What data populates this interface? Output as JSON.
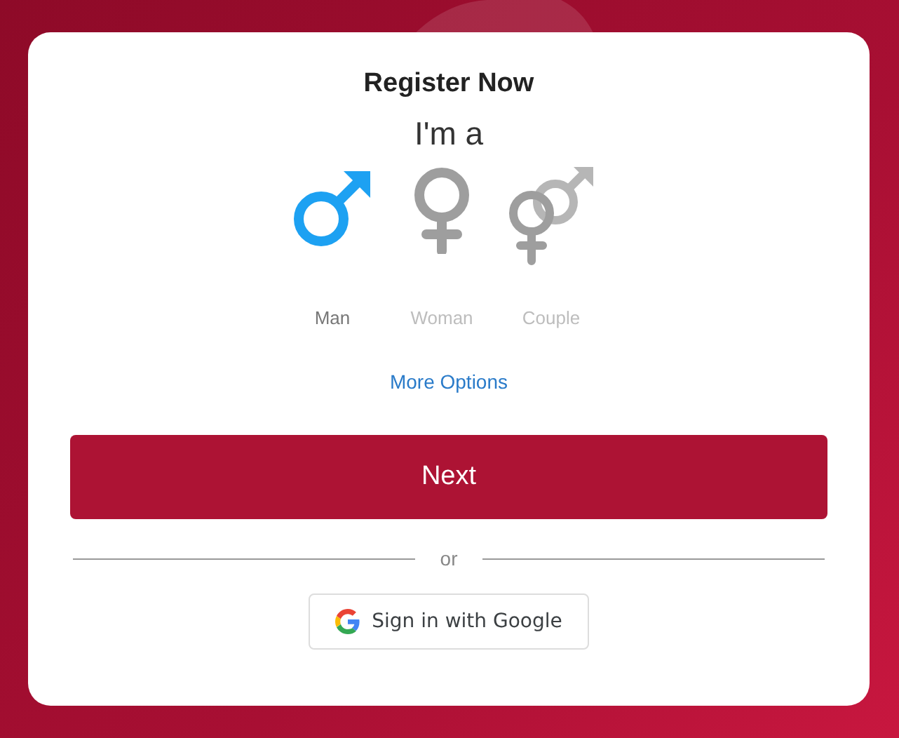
{
  "title": "Register Now",
  "subtitle": "I'm a",
  "options": [
    {
      "kind": "male",
      "label": "Man",
      "selected": true
    },
    {
      "kind": "female",
      "label": "Woman",
      "selected": false
    },
    {
      "kind": "couple",
      "label": "Couple",
      "selected": false
    }
  ],
  "more_link": "More Options",
  "next_button": "Next",
  "divider_text": "or",
  "google_button": "Sign in with Google"
}
